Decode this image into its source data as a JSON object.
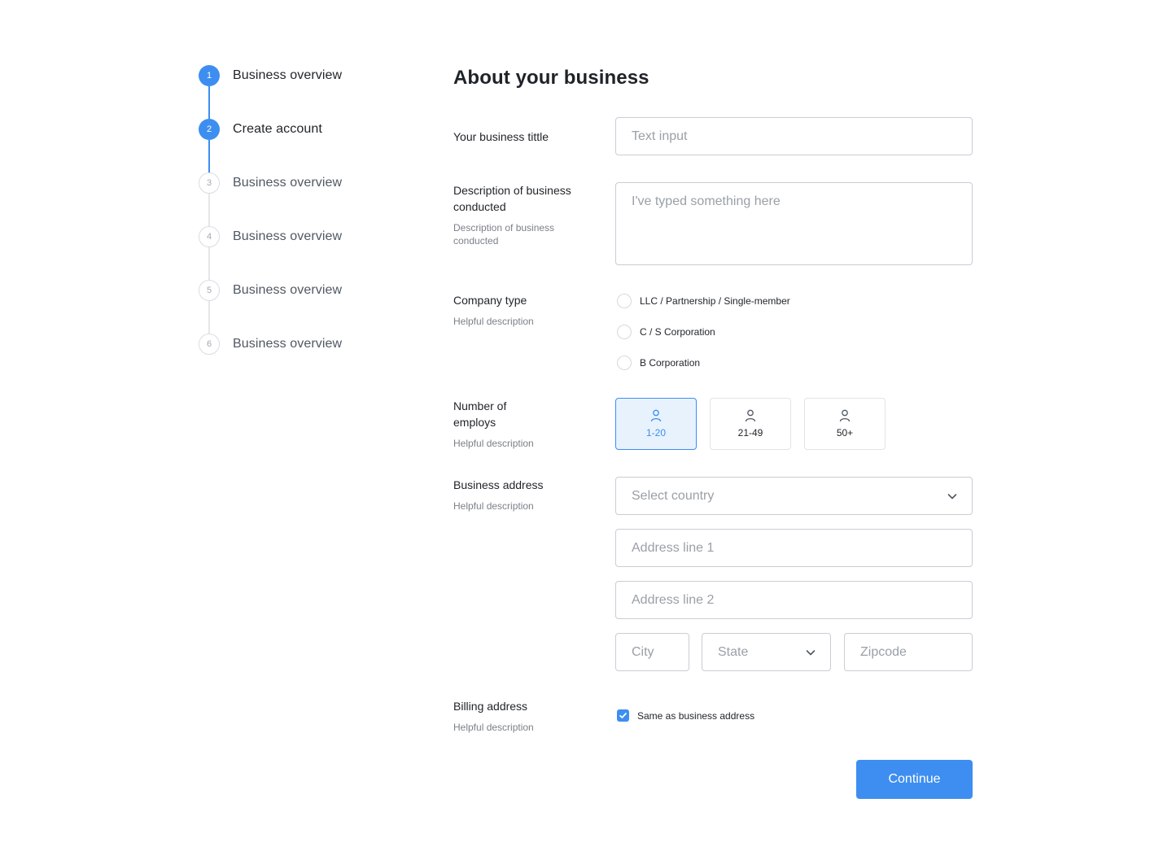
{
  "stepper": {
    "steps": [
      {
        "number": "1",
        "label": "Business overview",
        "state": "active"
      },
      {
        "number": "2",
        "label": "Create account",
        "state": "active"
      },
      {
        "number": "3",
        "label": "Business overview",
        "state": "inactive"
      },
      {
        "number": "4",
        "label": "Business overview",
        "state": "inactive"
      },
      {
        "number": "5",
        "label": "Business overview",
        "state": "inactive"
      },
      {
        "number": "6",
        "label": "Business overview",
        "state": "inactive"
      }
    ]
  },
  "form": {
    "title": "About your business",
    "business_title": {
      "label": "Your business tittle",
      "placeholder": "Text input"
    },
    "description": {
      "label": "Description of business conducted",
      "help": "Description of business conducted",
      "value": "I've typed something here"
    },
    "company_type": {
      "label": "Company type",
      "help": "Helpful description",
      "options": [
        "LLC / Partnership / Single-member",
        "C / S Corporation",
        "B Corporation"
      ]
    },
    "employees": {
      "label": "Number of employs",
      "help": "Helpful description",
      "options": [
        "1-20",
        "21-49",
        "50+"
      ],
      "selected": "1-20"
    },
    "business_address": {
      "label": "Business address",
      "help": "Helpful description",
      "country_placeholder": "Select country",
      "line1_placeholder": "Address line 1",
      "line2_placeholder": "Address line 2",
      "city_placeholder": "City",
      "state_placeholder": "State",
      "zip_placeholder": "Zipcode"
    },
    "billing_address": {
      "label": "Billing address",
      "help": "Helpful description",
      "checkbox_label": "Same as business address",
      "checked": true
    },
    "continue_label": "Continue"
  },
  "colors": {
    "accent": "#3d8ef0",
    "selected_bg": "#e7f2fd",
    "border": "#c9cdd2"
  }
}
